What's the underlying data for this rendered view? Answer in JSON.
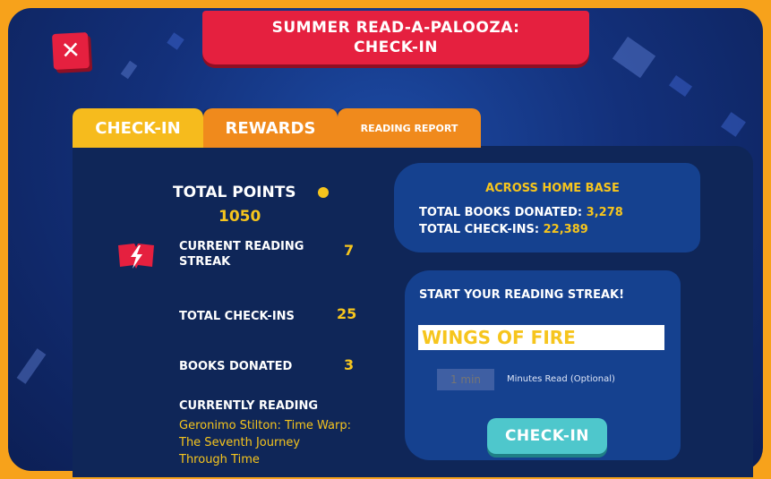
{
  "header": {
    "title_line1": "SUMMER READ-A-PALOOZA:",
    "title_line2": "CHECK-IN",
    "close_label": "✕"
  },
  "tabs": [
    {
      "label": "CHECK-IN",
      "active": true
    },
    {
      "label": "REWARDS",
      "active": false
    },
    {
      "label": "READING REPORT",
      "active": false
    }
  ],
  "stats": {
    "total_points_label": "TOTAL POINTS",
    "total_points_value": "1050",
    "streak_label_line1": "CURRENT READING",
    "streak_label_line2": "STREAK",
    "streak_value": "7",
    "checkins_label": "TOTAL CHECK-INS",
    "checkins_value": "25",
    "donated_label": "BOOKS DONATED",
    "donated_value": "3",
    "currently_reading_label": "CURRENTLY READING",
    "currently_reading_line1": "Geronimo Stilton: Time Warp:",
    "currently_reading_line2": "The Seventh Journey",
    "currently_reading_line3": "Through Time"
  },
  "home_base": {
    "title": "ACROSS HOME BASE",
    "books_donated_label": "TOTAL BOOKS DONATED:",
    "books_donated_value": "3,278",
    "checkins_label": "TOTAL CHECK-INS:",
    "checkins_value": "22,389"
  },
  "streak_form": {
    "title": "START YOUR READING STREAK!",
    "book_value": "WINGS OF FIRE",
    "minutes_placeholder": "1 min",
    "minutes_label": "Minutes Read (Optional)",
    "submit_label": "CHECK-IN"
  },
  "colors": {
    "accent_yellow": "#f6c51d",
    "banner_red": "#e5203f",
    "frame_orange": "#f7a21b",
    "button_teal": "#4ec7cc"
  },
  "icons": [
    "close-icon",
    "coin-icon",
    "lightning-book-icon"
  ]
}
